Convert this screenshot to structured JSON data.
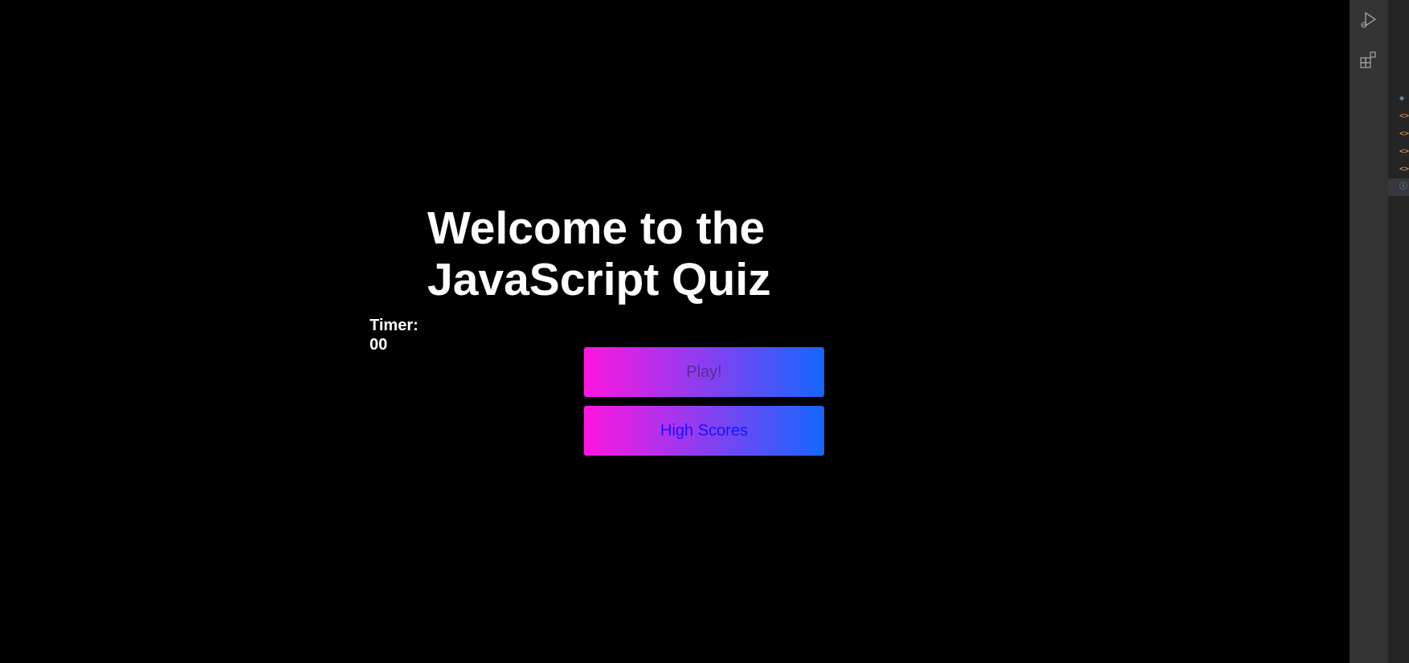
{
  "page": {
    "title": "Welcome to the JavaScript Quiz",
    "timer_label": "Timer:",
    "timer_value": "00"
  },
  "buttons": {
    "play_label": "Play!",
    "high_scores_label": "High Scores"
  },
  "colors": {
    "background": "#000000",
    "gradient_start": "#ff16e0",
    "gradient_end": "#1467ff",
    "play_text": "#5a2a9a",
    "high_scores_text": "#1a12ff",
    "activity_bar": "#333333"
  },
  "activity_bar": {
    "icons": [
      "run-debug-icon",
      "extensions-icon"
    ]
  },
  "side_panel": {
    "markers": [
      "file-icon",
      "code-icon",
      "code-icon",
      "code-icon",
      "code-icon",
      "info-icon"
    ]
  }
}
